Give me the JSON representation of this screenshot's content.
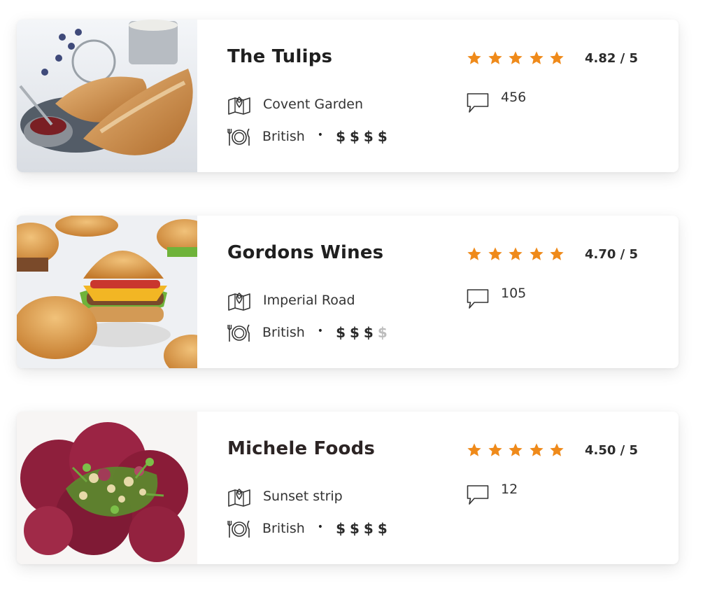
{
  "colors": {
    "accent": "#ef8a1a",
    "price_inactive": "#bdbdbd"
  },
  "icons": {
    "location": "map-pin-icon",
    "cuisine": "plate-cutlery-icon",
    "reviews": "speech-bubble-icon",
    "star": "star-icon"
  },
  "restaurants": [
    {
      "name": "The Tulips",
      "location": "Covent Garden",
      "cuisine": "British",
      "separator": "•",
      "price_symbol": "$",
      "price_level": 4,
      "price_max": 4,
      "stars": 5,
      "rating": "4.82 / 5",
      "reviews": "456",
      "photo": "croissants-photo"
    },
    {
      "name": "Gordons Wines",
      "location": "Imperial Road",
      "cuisine": "British",
      "separator": "•",
      "price_symbol": "$",
      "price_level": 3,
      "price_max": 4,
      "stars": 5,
      "rating": "4.70 / 5",
      "reviews": "105",
      "photo": "burgers-photo"
    },
    {
      "name": "Michele Foods",
      "location": "Sunset strip",
      "cuisine": "British",
      "separator": "•",
      "price_symbol": "$",
      "price_level": 4,
      "price_max": 4,
      "stars": 5,
      "rating": "4.50 / 5",
      "reviews": "12",
      "photo": "beet-carpaccio-photo"
    }
  ]
}
